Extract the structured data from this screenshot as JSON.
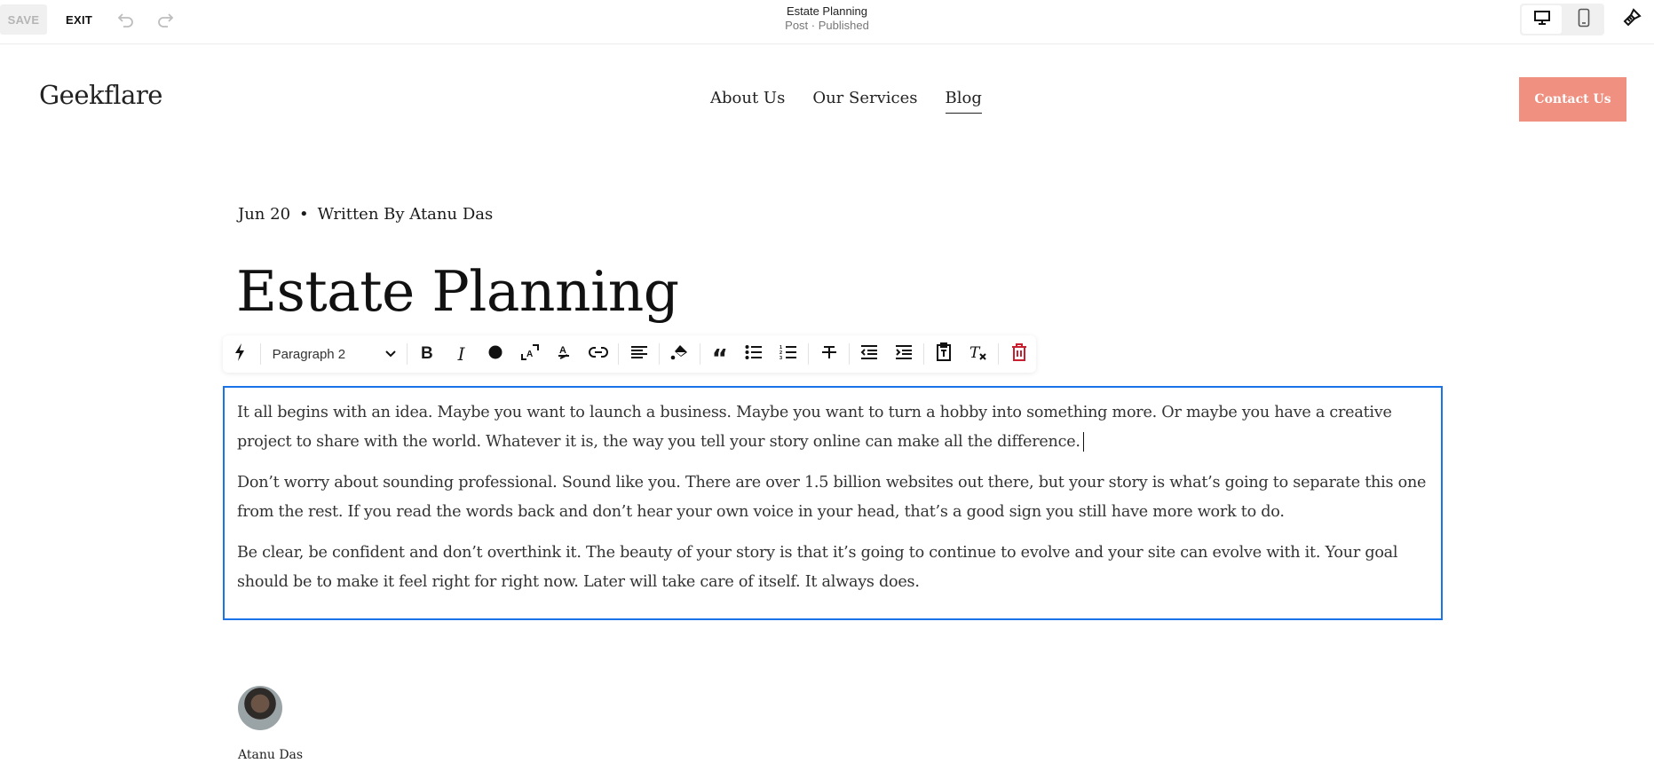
{
  "topbar": {
    "save_label": "SAVE",
    "exit_label": "EXIT",
    "undo_icon": "undo-icon",
    "redo_icon": "redo-icon",
    "doc_title": "Estate Planning",
    "doc_status": "Post · Published",
    "device_modes": [
      "desktop",
      "mobile"
    ],
    "active_device": "desktop",
    "design_icon": "paintbrush-icon"
  },
  "site": {
    "logo": "Geekflare",
    "nav": [
      {
        "label": "About Us",
        "active": false
      },
      {
        "label": "Our Services",
        "active": false
      },
      {
        "label": "Blog",
        "active": true
      }
    ],
    "cta_label": "Contact Us",
    "cta_color": "#ef9080"
  },
  "post": {
    "date": "Jun 20",
    "separator": "•",
    "byline": "Written By Atanu Das",
    "title": "Estate Planning",
    "paragraphs": [
      "It all begins with an idea. Maybe you want to launch a business. Maybe you want to turn a hobby into something more. Or maybe you have a creative project to share with the world. Whatever it is, the way you tell your story online can make all the difference.",
      "Don’t worry about sounding professional. Sound like you. There are over 1.5 billion websites out there, but your story is what’s going to separate this one from the rest. If you read the words back and don’t hear your own voice in your head, that’s a good sign you still have more work to do.",
      "Be clear, be confident and don’t overthink it. The beauty of your story is that it’s going to continue to evolve and your site can evolve with it. Your goal should be to make it feel right for right now. Later will take care of itself. It always does."
    ],
    "author_name": "Atanu Das"
  },
  "toolbar": {
    "paragraph_style": "Paragraph 2",
    "buttons": [
      "ai-assist",
      "bold",
      "italic",
      "text-color",
      "text-size",
      "highlight",
      "link",
      "align-left",
      "fill",
      "blockquote",
      "bulleted-list",
      "numbered-list",
      "strikethrough",
      "outdent",
      "indent",
      "paste-plain-text",
      "clear-formatting",
      "delete"
    ],
    "editor_border_color": "#1a73e8",
    "delete_color": "#c8202f"
  }
}
